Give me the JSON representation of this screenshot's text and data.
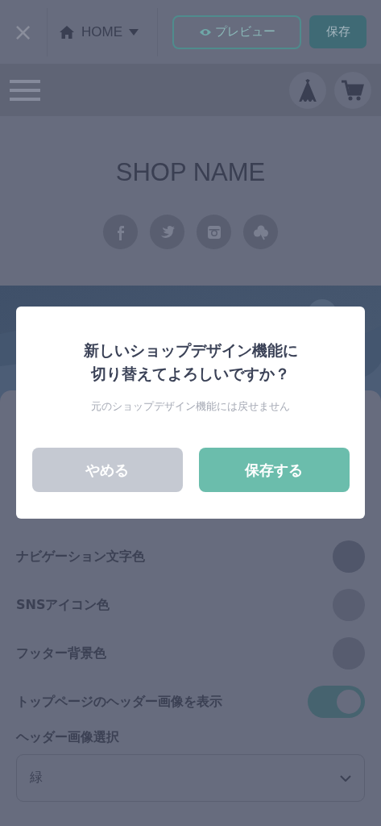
{
  "toolbar": {
    "close": "×",
    "page": "HOME",
    "preview": "プレビュー",
    "save": "保存"
  },
  "shop": {
    "name": "SHOP NAME"
  },
  "settings": {
    "rows": [
      {
        "kind": "color",
        "label": "ナビゲーション文字色",
        "color": "#50566a"
      },
      {
        "kind": "color",
        "label": "SNSアイコン色",
        "color": "#595e71"
      },
      {
        "kind": "color",
        "label": "フッター背景色",
        "color": "#575c6f"
      },
      {
        "kind": "toggle",
        "label": "トップページのヘッダー画像を表示",
        "on": true
      }
    ],
    "select_label": "ヘッダー画像選択",
    "select_value": "緑"
  },
  "dialog": {
    "title_lines": [
      "新しいショップデザイン機能に",
      "切り替えてよろしいですか？"
    ],
    "message": "元のショップデザイン機能には戻せません",
    "buttons": [
      {
        "label": "やめる",
        "kind": "cancel"
      },
      {
        "label": "保存する",
        "kind": "primary"
      }
    ]
  }
}
